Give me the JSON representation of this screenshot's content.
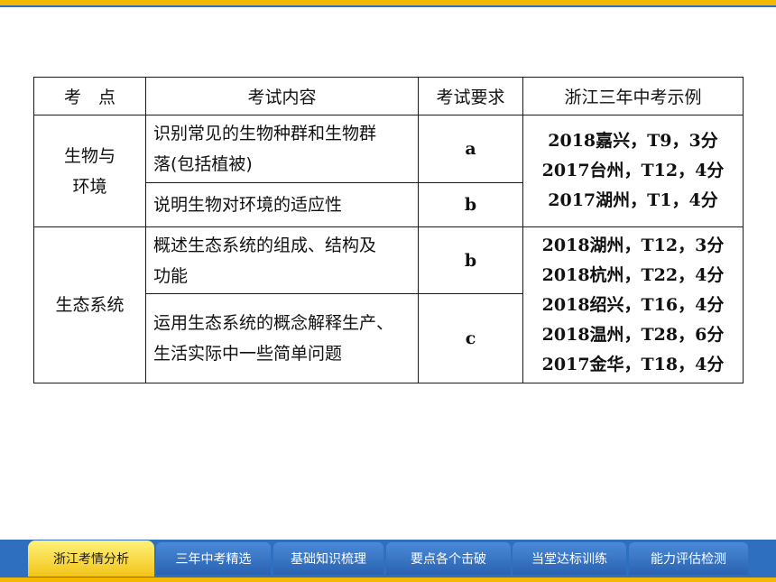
{
  "table": {
    "headers": [
      "考　点",
      "考试内容",
      "考试要求",
      "浙江三年中考示例"
    ],
    "groups": [
      {
        "topic": "生物与环境",
        "topic_lines": [
          "生物与",
          "环境"
        ],
        "rows": [
          {
            "content": "识别常见的生物种群和生物群落(包括植被)",
            "content_lines": [
              "识别常见的生物种群和生物群",
              "落(包括植被)"
            ],
            "requirement": "a"
          },
          {
            "content": "说明生物对环境的适应性",
            "content_lines": [
              "说明生物对环境的适应性"
            ],
            "requirement": "b"
          }
        ],
        "examples": [
          "2018嘉兴，T9，3分",
          "2017台州，T12，4分",
          "2017湖州，T1，4分"
        ]
      },
      {
        "topic": "生态系统",
        "topic_lines": [
          "生态系统"
        ],
        "rows": [
          {
            "content": "概述生态系统的组成、结构及功能",
            "content_lines": [
              "概述生态系统的组成、结构及",
              "功能"
            ],
            "requirement": "b"
          },
          {
            "content": "运用生态系统的概念解释生产、生活实际中一些简单问题",
            "content_lines": [
              "运用生态系统的概念解释生产、",
              "生活实际中一些简单问题"
            ],
            "requirement": "c"
          }
        ],
        "examples": [
          "2018湖州，T12，3分",
          "2018杭州，T22，4分",
          "2018绍兴，T16，4分",
          "2018温州，T28，6分",
          "2017金华，T18，4分"
        ]
      }
    ]
  },
  "nav": {
    "tabs": [
      "浙江考情分析",
      "三年中考精选",
      "基础知识梳理",
      "要点各个击破",
      "当堂达标训练",
      "能力评估检测"
    ],
    "active_index": 0
  },
  "colors": {
    "accent_yellow": "#f5b800",
    "accent_blue": "#2f6fc0"
  }
}
